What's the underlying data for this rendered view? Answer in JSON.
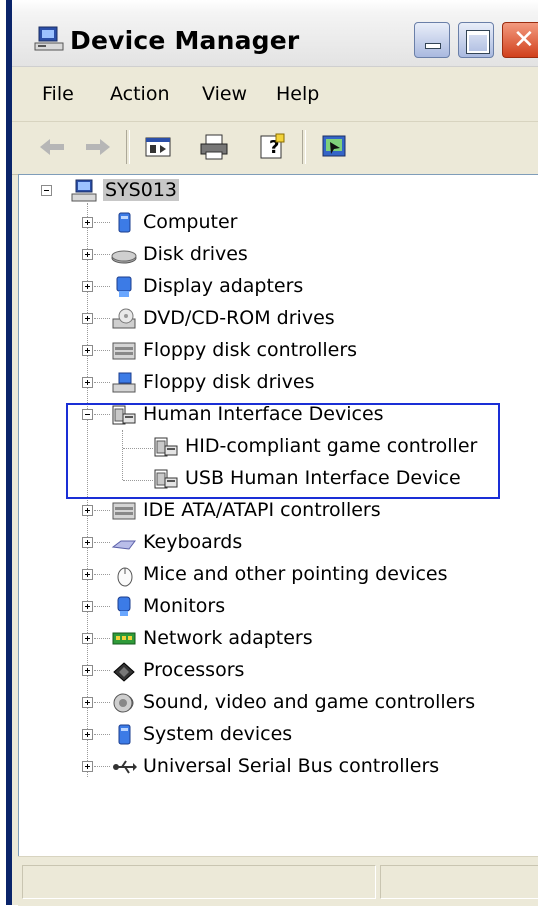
{
  "window": {
    "title": "Device Manager"
  },
  "menu": [
    {
      "label": "File"
    },
    {
      "label": "Action"
    },
    {
      "label": "View"
    },
    {
      "label": "Help"
    }
  ],
  "toolbar": {
    "buttons": [
      {
        "icon": "back-arrow-icon"
      },
      {
        "icon": "forward-arrow-icon"
      },
      {
        "icon": "properties-icon"
      },
      {
        "icon": "print-icon"
      },
      {
        "icon": "help-icon"
      },
      {
        "icon": "scan-hardware-icon"
      }
    ]
  },
  "tree": {
    "root": {
      "label": "SYS013"
    },
    "categories": [
      {
        "label": "Computer",
        "icon": "computer-icon"
      },
      {
        "label": "Disk drives",
        "icon": "disk-drive-icon"
      },
      {
        "label": "Display adapters",
        "icon": "display-adapter-icon"
      },
      {
        "label": "DVD/CD-ROM drives",
        "icon": "dvd-drive-icon"
      },
      {
        "label": "Floppy disk controllers",
        "icon": "controller-icon"
      },
      {
        "label": "Floppy disk drives",
        "icon": "floppy-drive-icon"
      },
      {
        "label": "Human Interface Devices",
        "icon": "hid-icon",
        "expanded": true,
        "children": [
          {
            "label": "HID-compliant game controller",
            "icon": "hid-icon"
          },
          {
            "label": "USB Human Interface Device",
            "icon": "hid-icon"
          }
        ]
      },
      {
        "label": "IDE ATA/ATAPI controllers",
        "icon": "controller-icon"
      },
      {
        "label": "Keyboards",
        "icon": "keyboard-icon"
      },
      {
        "label": "Mice and other pointing devices",
        "icon": "mouse-icon"
      },
      {
        "label": "Monitors",
        "icon": "monitor-icon"
      },
      {
        "label": "Network adapters",
        "icon": "network-adapter-icon"
      },
      {
        "label": "Processors",
        "icon": "processor-icon"
      },
      {
        "label": "Sound, video and game controllers",
        "icon": "sound-icon"
      },
      {
        "label": "System devices",
        "icon": "system-device-icon"
      },
      {
        "label": "Universal Serial Bus controllers",
        "icon": "usb-icon"
      }
    ]
  },
  "colors": {
    "highlight_box": "#1a2fd6",
    "root_selection": "#c7c7c7"
  }
}
